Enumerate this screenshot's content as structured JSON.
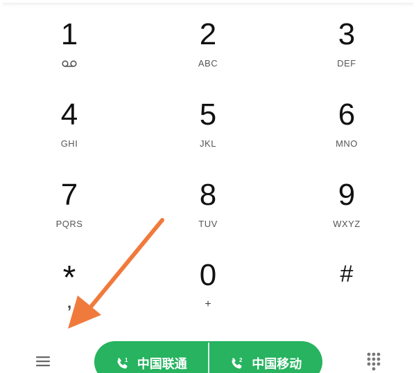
{
  "keypad": {
    "keys": [
      {
        "digit": "1",
        "letters": "",
        "icon": "voicemail-icon"
      },
      {
        "digit": "2",
        "letters": "ABC"
      },
      {
        "digit": "3",
        "letters": "DEF"
      },
      {
        "digit": "4",
        "letters": "GHI"
      },
      {
        "digit": "5",
        "letters": "JKL"
      },
      {
        "digit": "6",
        "letters": "MNO"
      },
      {
        "digit": "7",
        "letters": "PQRS"
      },
      {
        "digit": "8",
        "letters": "TUV"
      },
      {
        "digit": "9",
        "letters": "WXYZ"
      },
      {
        "digit": "*",
        "letters": ","
      },
      {
        "digit": "0",
        "letters": "+"
      },
      {
        "digit": "#",
        "letters": ""
      }
    ]
  },
  "bottom_bar": {
    "menu_icon": "menu-icon",
    "dialpad_icon": "dialpad-icon",
    "sim1": {
      "label": "中国联通",
      "icon": "phone-sim1-icon",
      "sim_number": "1"
    },
    "sim2": {
      "label": "中国移动",
      "icon": "phone-sim2-icon",
      "sim_number": "2"
    }
  },
  "colors": {
    "call_green": "#27b35f",
    "annotation_arrow": "#f07a3c",
    "digit_text": "#111111",
    "letters_text": "#555555"
  }
}
